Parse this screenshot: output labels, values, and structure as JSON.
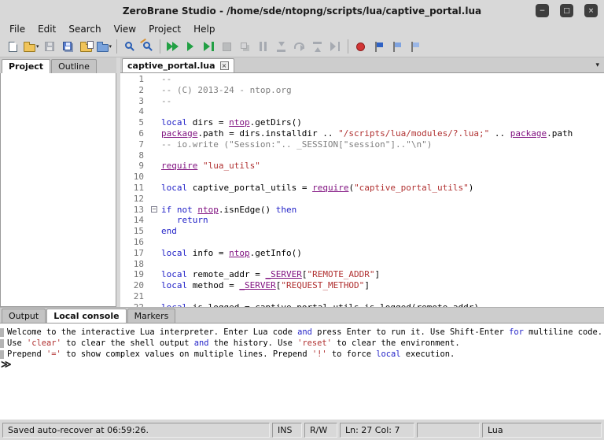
{
  "colors": {
    "keyword": "#2323c8",
    "string": "#b03030",
    "comment": "#7f7f7f",
    "global": "#7f0f7f",
    "plain": "#000000",
    "line_number": "#737373",
    "chrome": "#d8d8d8"
  },
  "window": {
    "title": "ZeroBrane Studio - /home/sde/ntopng/scripts/lua/captive_portal.lua",
    "controls": [
      {
        "name": "minimize-button",
        "icon": "minimize-icon",
        "glyph": "−"
      },
      {
        "name": "maximize-button",
        "icon": "maximize-icon",
        "glyph": "□"
      },
      {
        "name": "close-button",
        "icon": "close-icon",
        "glyph": "×"
      }
    ]
  },
  "menubar": {
    "items": [
      "File",
      "Edit",
      "Search",
      "View",
      "Project",
      "Help"
    ]
  },
  "toolbar": {
    "items": [
      {
        "name": "new-file-button",
        "icon": "new-file-icon",
        "shape": "page",
        "enabled": true
      },
      {
        "name": "open-file-button",
        "icon": "open-folder-icon",
        "shape": "folder",
        "enabled": true,
        "dropdown": true
      },
      {
        "name": "save-button",
        "icon": "save-icon",
        "shape": "floppy",
        "enabled": false
      },
      {
        "name": "save-all-button",
        "icon": "save-all-icon",
        "shape": "floppy2",
        "enabled": true
      },
      {
        "name": "project-dir-from-file-button",
        "icon": "folder-file-icon",
        "shape": "folderfile",
        "enabled": true
      },
      {
        "name": "project-dir-choose-button",
        "icon": "folder-choose-icon",
        "shape": "folderblue",
        "enabled": true,
        "dropdown": true
      },
      {
        "separator": true
      },
      {
        "name": "find-button",
        "icon": "find-icon",
        "shape": "find",
        "enabled": true
      },
      {
        "name": "find-replace-button",
        "icon": "find-replace-icon",
        "shape": "findrep",
        "enabled": true
      },
      {
        "separator": true
      },
      {
        "name": "run-button",
        "icon": "run-icon",
        "shape": "run",
        "enabled": true
      },
      {
        "name": "start-debugging-button",
        "icon": "play-icon",
        "shape": "play",
        "enabled": true
      },
      {
        "name": "continue-button",
        "icon": "play-bar-icon",
        "shape": "playbar",
        "enabled": true
      },
      {
        "name": "stop-process-button",
        "icon": "stop-icon",
        "shape": "stop",
        "enabled": false
      },
      {
        "name": "detach-process-button",
        "icon": "detach-icon",
        "shape": "detach",
        "enabled": false
      },
      {
        "name": "break-process-button",
        "icon": "pause-icon",
        "shape": "pause",
        "enabled": false
      },
      {
        "name": "step-into-button",
        "icon": "step-into-icon",
        "shape": "stepin",
        "enabled": false
      },
      {
        "name": "step-over-button",
        "icon": "step-over-icon",
        "shape": "stepover",
        "enabled": false
      },
      {
        "name": "step-out-button",
        "icon": "step-out-icon",
        "shape": "stepout",
        "enabled": false
      },
      {
        "name": "run-to-cursor-button",
        "icon": "run-to-cursor-icon",
        "shape": "runto",
        "enabled": false
      },
      {
        "separator": true
      },
      {
        "name": "toggle-breakpoint-button",
        "icon": "breakpoint-icon",
        "shape": "breakpoint",
        "enabled": true
      },
      {
        "name": "toggle-bookmark-button",
        "icon": "bookmark-icon",
        "shape": "flag",
        "enabled": true
      },
      {
        "name": "bookmark-prev-button",
        "icon": "bookmark-prev-icon",
        "shape": "flagprev",
        "enabled": true
      },
      {
        "name": "bookmark-next-button",
        "icon": "bookmark-next-icon",
        "shape": "flagnext",
        "enabled": true
      }
    ]
  },
  "left_panel": {
    "tabs": [
      {
        "label": "Project",
        "active": true
      },
      {
        "label": "Outline",
        "active": false
      }
    ]
  },
  "editor": {
    "tab": {
      "label": "captive_portal.lua",
      "close_glyph": "×"
    },
    "tab_list_glyph": "▾",
    "fold_glyph": "−",
    "lines": [
      {
        "n": 1,
        "tokens": [
          {
            "t": "com",
            "s": "--"
          }
        ]
      },
      {
        "n": 2,
        "tokens": [
          {
            "t": "com",
            "s": "-- (C) 2013-24 - ntop.org"
          }
        ]
      },
      {
        "n": 3,
        "tokens": [
          {
            "t": "com",
            "s": "--"
          }
        ]
      },
      {
        "n": 4,
        "tokens": []
      },
      {
        "n": 5,
        "tokens": [
          {
            "t": "kw",
            "s": "local "
          },
          {
            "t": "plain",
            "s": "dirs = "
          },
          {
            "t": "glob",
            "s": "ntop"
          },
          {
            "t": "plain",
            "s": ".getDirs()"
          }
        ]
      },
      {
        "n": 6,
        "tokens": [
          {
            "t": "glob",
            "s": "package"
          },
          {
            "t": "plain",
            "s": ".path = dirs.installdir .. "
          },
          {
            "t": "str",
            "s": "\"/scripts/lua/modules/?.lua;\""
          },
          {
            "t": "plain",
            "s": " .. "
          },
          {
            "t": "glob",
            "s": "package"
          },
          {
            "t": "plain",
            "s": ".path"
          }
        ]
      },
      {
        "n": 7,
        "tokens": [
          {
            "t": "com",
            "s": "-- io.write (\"Session:\".. _SESSION[\"session\"]..\"\\n\")"
          }
        ]
      },
      {
        "n": 8,
        "tokens": []
      },
      {
        "n": 9,
        "tokens": [
          {
            "t": "glob",
            "s": "require"
          },
          {
            "t": "plain",
            "s": " "
          },
          {
            "t": "str",
            "s": "\"lua_utils\""
          }
        ]
      },
      {
        "n": 10,
        "tokens": []
      },
      {
        "n": 11,
        "tokens": [
          {
            "t": "kw",
            "s": "local "
          },
          {
            "t": "plain",
            "s": "captive_portal_utils = "
          },
          {
            "t": "glob",
            "s": "require"
          },
          {
            "t": "plain",
            "s": "("
          },
          {
            "t": "str",
            "s": "\"captive_portal_utils\""
          },
          {
            "t": "plain",
            "s": ")"
          }
        ]
      },
      {
        "n": 12,
        "tokens": []
      },
      {
        "n": 13,
        "fold": true,
        "tokens": [
          {
            "t": "kw",
            "s": "if "
          },
          {
            "t": "kw",
            "s": "not "
          },
          {
            "t": "glob",
            "s": "ntop"
          },
          {
            "t": "plain",
            "s": ".isnEdge() "
          },
          {
            "t": "kw",
            "s": "then"
          }
        ]
      },
      {
        "n": 14,
        "tokens": [
          {
            "t": "plain",
            "s": "   "
          },
          {
            "t": "kw",
            "s": "return"
          }
        ]
      },
      {
        "n": 15,
        "tokens": [
          {
            "t": "kw",
            "s": "end"
          }
        ]
      },
      {
        "n": 16,
        "tokens": []
      },
      {
        "n": 17,
        "tokens": [
          {
            "t": "kw",
            "s": "local "
          },
          {
            "t": "plain",
            "s": "info = "
          },
          {
            "t": "glob",
            "s": "ntop"
          },
          {
            "t": "plain",
            "s": ".getInfo()"
          }
        ]
      },
      {
        "n": 18,
        "tokens": []
      },
      {
        "n": 19,
        "tokens": [
          {
            "t": "kw",
            "s": "local "
          },
          {
            "t": "plain",
            "s": "remote_addr = "
          },
          {
            "t": "glob",
            "s": "_SERVER"
          },
          {
            "t": "plain",
            "s": "["
          },
          {
            "t": "str",
            "s": "\"REMOTE_ADDR\""
          },
          {
            "t": "plain",
            "s": "]"
          }
        ]
      },
      {
        "n": 20,
        "tokens": [
          {
            "t": "kw",
            "s": "local "
          },
          {
            "t": "plain",
            "s": "method = "
          },
          {
            "t": "glob",
            "s": "_SERVER"
          },
          {
            "t": "plain",
            "s": "["
          },
          {
            "t": "str",
            "s": "\"REQUEST_METHOD\""
          },
          {
            "t": "plain",
            "s": "]"
          }
        ]
      },
      {
        "n": 21,
        "tokens": []
      },
      {
        "n": 22,
        "tokens": [
          {
            "t": "kw",
            "s": "local "
          },
          {
            "t": "plain",
            "s": "is_logged = captive_portal_utils.is_logged(remote_addr)"
          }
        ]
      }
    ]
  },
  "bottom_panel": {
    "tabs": [
      {
        "label": "Output",
        "active": false
      },
      {
        "label": "Local console",
        "active": true
      },
      {
        "label": "Markers",
        "active": false
      }
    ],
    "console": {
      "lines": [
        {
          "tokens": [
            {
              "t": "plain",
              "s": "Welcome to the interactive Lua interpreter. Enter Lua code "
            },
            {
              "t": "kw",
              "s": "and"
            },
            {
              "t": "plain",
              "s": " press Enter to run it. Use Shift-Enter "
            },
            {
              "t": "kw",
              "s": "for"
            },
            {
              "t": "plain",
              "s": " multiline code."
            }
          ]
        },
        {
          "tokens": [
            {
              "t": "plain",
              "s": "Use "
            },
            {
              "t": "str",
              "s": "'clear'"
            },
            {
              "t": "plain",
              "s": " to clear the shell output "
            },
            {
              "t": "kw",
              "s": "and"
            },
            {
              "t": "plain",
              "s": " the history. Use "
            },
            {
              "t": "str",
              "s": "'reset'"
            },
            {
              "t": "plain",
              "s": " to clear the environment."
            }
          ]
        },
        {
          "tokens": [
            {
              "t": "plain",
              "s": "Prepend "
            },
            {
              "t": "str",
              "s": "'='"
            },
            {
              "t": "plain",
              "s": " to show complex values on multiple lines. Prepend "
            },
            {
              "t": "str",
              "s": "'!'"
            },
            {
              "t": "plain",
              "s": " to force "
            },
            {
              "t": "kw",
              "s": "local"
            },
            {
              "t": "plain",
              "s": " execution."
            }
          ]
        }
      ],
      "prompt": "≫"
    }
  },
  "statusbar": {
    "message": "Saved auto-recover at 06:59:26.",
    "overtype": "INS",
    "readwrite": "R/W",
    "position": "Ln: 27 Col: 7",
    "filetype": "Lua"
  }
}
